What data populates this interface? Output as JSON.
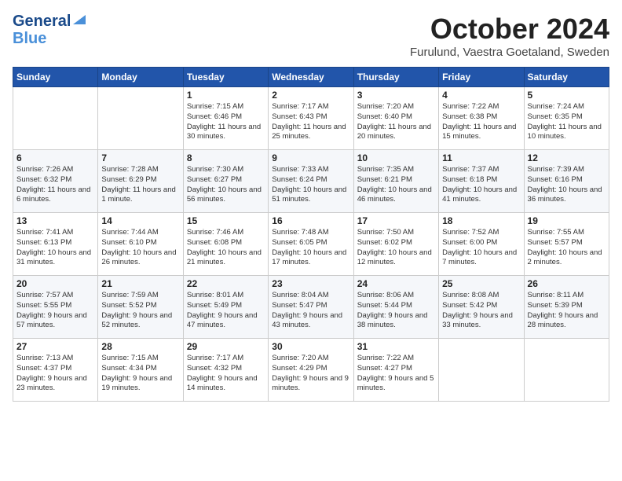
{
  "header": {
    "logo_general": "General",
    "logo_blue": "Blue",
    "month_title": "October 2024",
    "location": "Furulund, Vaestra Goetaland, Sweden"
  },
  "days_of_week": [
    "Sunday",
    "Monday",
    "Tuesday",
    "Wednesday",
    "Thursday",
    "Friday",
    "Saturday"
  ],
  "weeks": [
    [
      {
        "day": "",
        "text": ""
      },
      {
        "day": "",
        "text": ""
      },
      {
        "day": "1",
        "text": "Sunrise: 7:15 AM\nSunset: 6:46 PM\nDaylight: 11 hours and 30 minutes."
      },
      {
        "day": "2",
        "text": "Sunrise: 7:17 AM\nSunset: 6:43 PM\nDaylight: 11 hours and 25 minutes."
      },
      {
        "day": "3",
        "text": "Sunrise: 7:20 AM\nSunset: 6:40 PM\nDaylight: 11 hours and 20 minutes."
      },
      {
        "day": "4",
        "text": "Sunrise: 7:22 AM\nSunset: 6:38 PM\nDaylight: 11 hours and 15 minutes."
      },
      {
        "day": "5",
        "text": "Sunrise: 7:24 AM\nSunset: 6:35 PM\nDaylight: 11 hours and 10 minutes."
      }
    ],
    [
      {
        "day": "6",
        "text": "Sunrise: 7:26 AM\nSunset: 6:32 PM\nDaylight: 11 hours and 6 minutes."
      },
      {
        "day": "7",
        "text": "Sunrise: 7:28 AM\nSunset: 6:29 PM\nDaylight: 11 hours and 1 minute."
      },
      {
        "day": "8",
        "text": "Sunrise: 7:30 AM\nSunset: 6:27 PM\nDaylight: 10 hours and 56 minutes."
      },
      {
        "day": "9",
        "text": "Sunrise: 7:33 AM\nSunset: 6:24 PM\nDaylight: 10 hours and 51 minutes."
      },
      {
        "day": "10",
        "text": "Sunrise: 7:35 AM\nSunset: 6:21 PM\nDaylight: 10 hours and 46 minutes."
      },
      {
        "day": "11",
        "text": "Sunrise: 7:37 AM\nSunset: 6:18 PM\nDaylight: 10 hours and 41 minutes."
      },
      {
        "day": "12",
        "text": "Sunrise: 7:39 AM\nSunset: 6:16 PM\nDaylight: 10 hours and 36 minutes."
      }
    ],
    [
      {
        "day": "13",
        "text": "Sunrise: 7:41 AM\nSunset: 6:13 PM\nDaylight: 10 hours and 31 minutes."
      },
      {
        "day": "14",
        "text": "Sunrise: 7:44 AM\nSunset: 6:10 PM\nDaylight: 10 hours and 26 minutes."
      },
      {
        "day": "15",
        "text": "Sunrise: 7:46 AM\nSunset: 6:08 PM\nDaylight: 10 hours and 21 minutes."
      },
      {
        "day": "16",
        "text": "Sunrise: 7:48 AM\nSunset: 6:05 PM\nDaylight: 10 hours and 17 minutes."
      },
      {
        "day": "17",
        "text": "Sunrise: 7:50 AM\nSunset: 6:02 PM\nDaylight: 10 hours and 12 minutes."
      },
      {
        "day": "18",
        "text": "Sunrise: 7:52 AM\nSunset: 6:00 PM\nDaylight: 10 hours and 7 minutes."
      },
      {
        "day": "19",
        "text": "Sunrise: 7:55 AM\nSunset: 5:57 PM\nDaylight: 10 hours and 2 minutes."
      }
    ],
    [
      {
        "day": "20",
        "text": "Sunrise: 7:57 AM\nSunset: 5:55 PM\nDaylight: 9 hours and 57 minutes."
      },
      {
        "day": "21",
        "text": "Sunrise: 7:59 AM\nSunset: 5:52 PM\nDaylight: 9 hours and 52 minutes."
      },
      {
        "day": "22",
        "text": "Sunrise: 8:01 AM\nSunset: 5:49 PM\nDaylight: 9 hours and 47 minutes."
      },
      {
        "day": "23",
        "text": "Sunrise: 8:04 AM\nSunset: 5:47 PM\nDaylight: 9 hours and 43 minutes."
      },
      {
        "day": "24",
        "text": "Sunrise: 8:06 AM\nSunset: 5:44 PM\nDaylight: 9 hours and 38 minutes."
      },
      {
        "day": "25",
        "text": "Sunrise: 8:08 AM\nSunset: 5:42 PM\nDaylight: 9 hours and 33 minutes."
      },
      {
        "day": "26",
        "text": "Sunrise: 8:11 AM\nSunset: 5:39 PM\nDaylight: 9 hours and 28 minutes."
      }
    ],
    [
      {
        "day": "27",
        "text": "Sunrise: 7:13 AM\nSunset: 4:37 PM\nDaylight: 9 hours and 23 minutes."
      },
      {
        "day": "28",
        "text": "Sunrise: 7:15 AM\nSunset: 4:34 PM\nDaylight: 9 hours and 19 minutes."
      },
      {
        "day": "29",
        "text": "Sunrise: 7:17 AM\nSunset: 4:32 PM\nDaylight: 9 hours and 14 minutes."
      },
      {
        "day": "30",
        "text": "Sunrise: 7:20 AM\nSunset: 4:29 PM\nDaylight: 9 hours and 9 minutes."
      },
      {
        "day": "31",
        "text": "Sunrise: 7:22 AM\nSunset: 4:27 PM\nDaylight: 9 hours and 5 minutes."
      },
      {
        "day": "",
        "text": ""
      },
      {
        "day": "",
        "text": ""
      }
    ]
  ]
}
